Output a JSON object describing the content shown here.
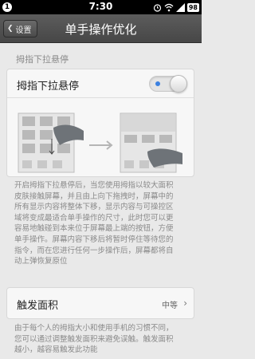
{
  "status_bar": {
    "notification": "1",
    "time": "7:30",
    "battery": "98"
  },
  "title_bar": {
    "back_label": "设置",
    "title": "单手操作优化"
  },
  "section": {
    "label": "拇指下拉悬停"
  },
  "toggle": {
    "label": "拇指下拉悬停",
    "state": "on",
    "accent": "#3b80e0"
  },
  "description": {
    "lines": [
      "开启拇指下拉悬停后，当您使用拇指以较大面积",
      "皮肤接触屏幕，并且由上向下拖拽时，屏幕中的",
      "所有显示内容将整体下移，显示内容与可操控区",
      "域将变成最适合单手操作的尺寸，此时您可以更",
      "容易地触碰到本来位于屏幕最上端的按钮，方便",
      "单手操作。屏幕内容下移后将暂时停住等待您的",
      "指令，而在您进行任何一步操作后，屏幕都将自",
      "动上弹恢复原位"
    ]
  },
  "trigger_area": {
    "label": "触发面积",
    "value": "中等"
  },
  "footnote": {
    "lines": [
      "由于每个人的拇指大小和使用手机的习惯不同，",
      "您可以通过调整触发面积来避免误触。触发面积",
      "越小，越容易触发此功能"
    ]
  }
}
